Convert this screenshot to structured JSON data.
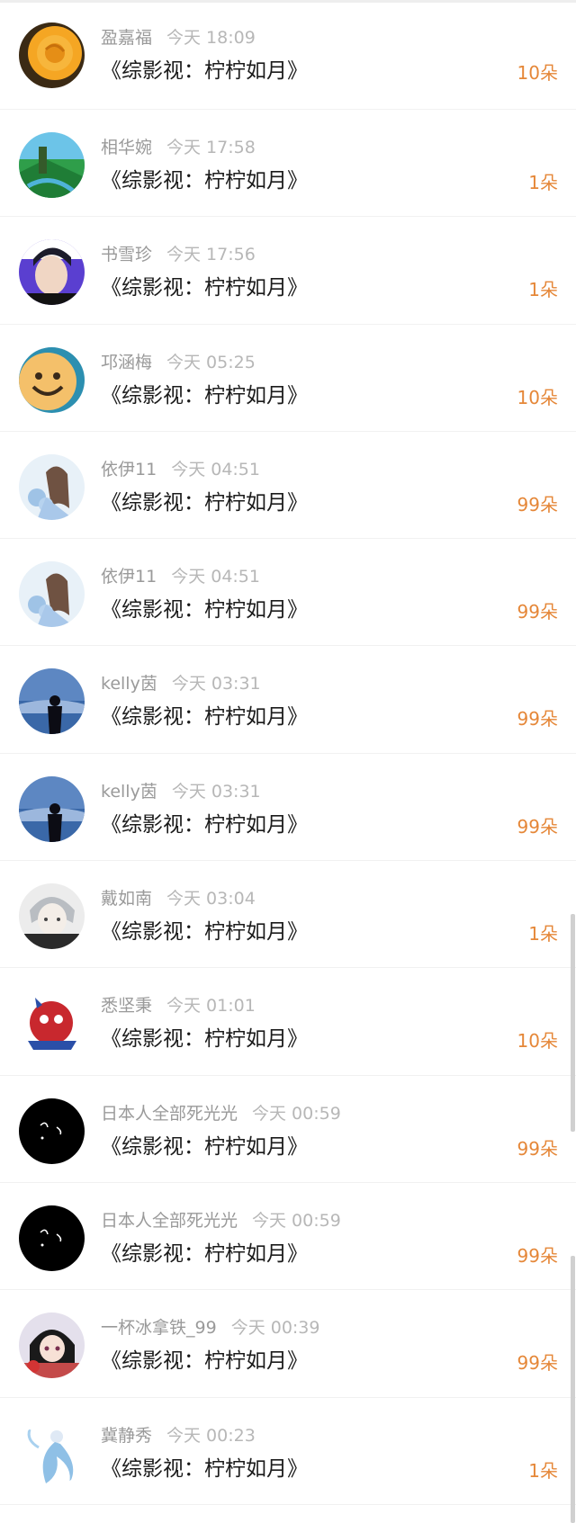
{
  "gifts": [
    {
      "name": "盈嘉福",
      "time": "今天 18:09",
      "title": "《综影视：柠柠如月》",
      "count": "10朵",
      "avatar": "rose-avatar-icon"
    },
    {
      "name": "相华婉",
      "time": "今天 17:58",
      "title": "《综影视：柠柠如月》",
      "count": "1朵",
      "avatar": "landscape-avatar-icon"
    },
    {
      "name": "书雪珍",
      "time": "今天 17:56",
      "title": "《综影视：柠柠如月》",
      "count": "1朵",
      "avatar": "portrait-avatar-icon"
    },
    {
      "name": "邛涵梅",
      "time": "今天 05:25",
      "title": "《综影视：柠柠如月》",
      "count": "10朵",
      "avatar": "smiley-avatar-icon"
    },
    {
      "name": "依伊11",
      "time": "今天 04:51",
      "title": "《综影视：柠柠如月》",
      "count": "99朵",
      "avatar": "girl-flowers-avatar-icon"
    },
    {
      "name": "依伊11",
      "time": "今天 04:51",
      "title": "《综影视：柠柠如月》",
      "count": "99朵",
      "avatar": "girl-flowers-avatar-icon"
    },
    {
      "name": "kelly茵",
      "time": "今天 03:31",
      "title": "《综影视：柠柠如月》",
      "count": "99朵",
      "avatar": "silhouette-avatar-icon"
    },
    {
      "name": "kelly茵",
      "time": "今天 03:31",
      "title": "《综影视：柠柠如月》",
      "count": "99朵",
      "avatar": "silhouette-avatar-icon"
    },
    {
      "name": "戴如南",
      "time": "今天 03:04",
      "title": "《综影视：柠柠如月》",
      "count": "1朵",
      "avatar": "anime-boy-avatar-icon"
    },
    {
      "name": "悉坚秉",
      "time": "今天 01:01",
      "title": "《综影视：柠柠如月》",
      "count": "10朵",
      "avatar": "mascot-avatar-icon"
    },
    {
      "name": "日本人全部死光光",
      "time": "今天 00:59",
      "title": "《综影视：柠柠如月》",
      "count": "99朵",
      "avatar": "dark-face-avatar-icon"
    },
    {
      "name": "日本人全部死光光",
      "time": "今天 00:59",
      "title": "《综影视：柠柠如月》",
      "count": "99朵",
      "avatar": "dark-face-avatar-icon"
    },
    {
      "name": "一杯冰拿铁_99",
      "time": "今天 00:39",
      "title": "《综影视：柠柠如月》",
      "count": "99朵",
      "avatar": "anime-girl-avatar-icon"
    },
    {
      "name": "冀静秀",
      "time": "今天 00:23",
      "title": "《综影视：柠柠如月》",
      "count": "1朵",
      "avatar": "fairy-avatar-icon"
    }
  ],
  "colors": {
    "count": "#e58738",
    "name": "#9a9a9a",
    "time": "#b7b7b7",
    "title": "#1b1b1b"
  }
}
